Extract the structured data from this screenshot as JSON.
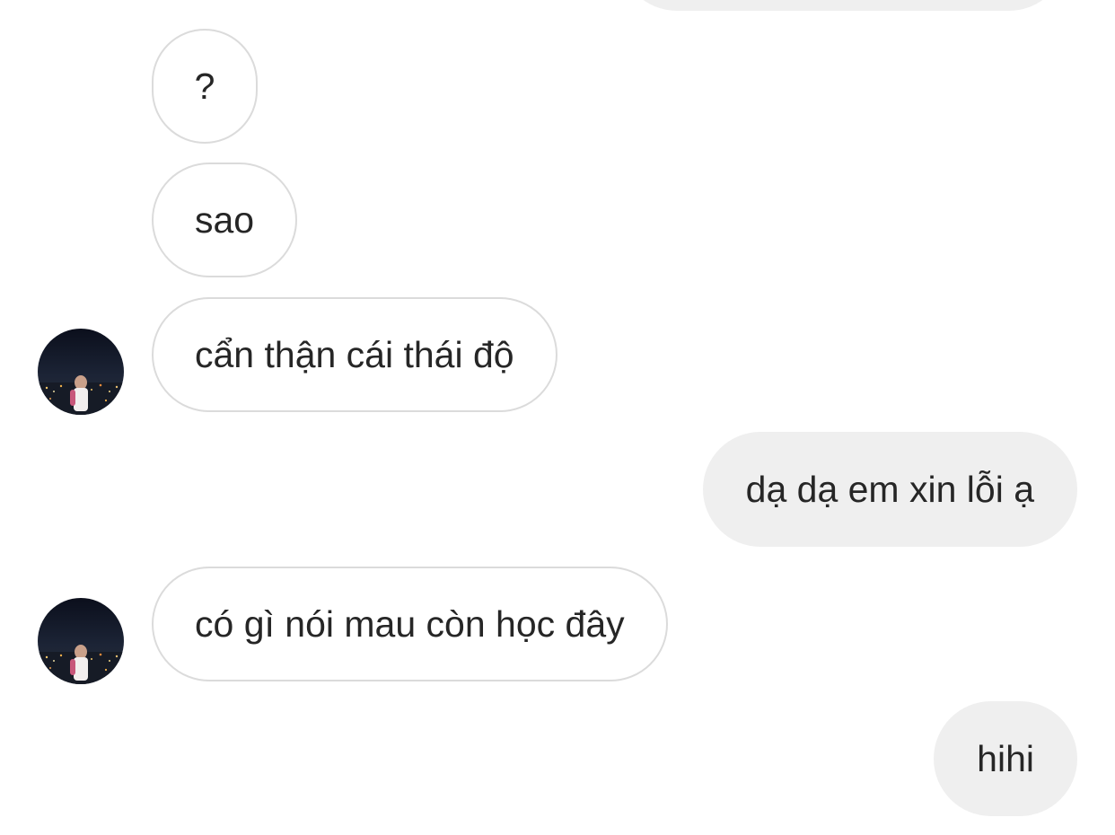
{
  "conversation": {
    "messages": [
      {
        "side": "incoming",
        "text": "?"
      },
      {
        "side": "incoming",
        "text": "sao"
      },
      {
        "side": "incoming",
        "text": "cẩn thận cái thái độ",
        "has_avatar": true
      },
      {
        "side": "outgoing",
        "text": "dạ dạ em xin lỗi ạ"
      },
      {
        "side": "incoming",
        "text": "có gì nói mau còn học đây",
        "has_avatar": true
      },
      {
        "side": "outgoing",
        "text": "hihi"
      }
    ]
  },
  "theme": {
    "incoming_bubble_bg": "#ffffff",
    "incoming_bubble_border": "#dbdbdb",
    "outgoing_bubble_bg": "#efefef",
    "text_color": "#262626"
  },
  "icons": {
    "avatar": "contact-avatar-city-night-photo"
  }
}
